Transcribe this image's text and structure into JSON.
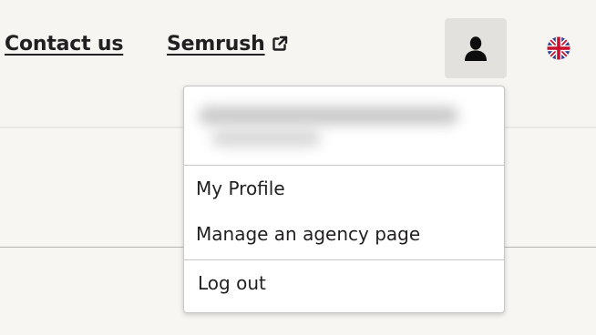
{
  "nav": {
    "contact_label": "Contact us",
    "semrush_label": "Semrush",
    "semrush_icon": "external-link-icon"
  },
  "header": {
    "user_icon": "user-icon",
    "language_icon": "uk-flag-icon"
  },
  "user_menu": {
    "items": [
      {
        "label": "My Profile"
      },
      {
        "label": "Manage an agency page"
      }
    ],
    "logout_label": "Log out"
  },
  "colors": {
    "text": "#211f20",
    "page_background": "#f7f6f3",
    "user_button_background": "#e2e1de",
    "menu_background": "#ffffff",
    "divider": "#c9c7c3"
  }
}
